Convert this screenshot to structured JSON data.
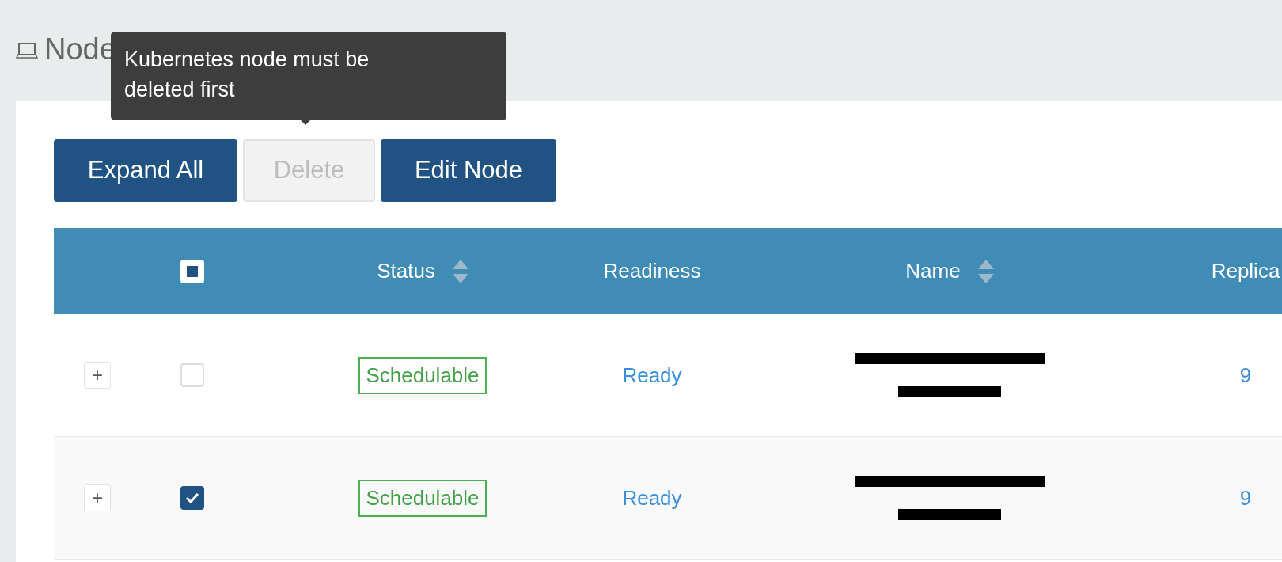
{
  "page": {
    "title": "Node"
  },
  "tooltip": {
    "text": "Kubernetes node must be deleted first"
  },
  "toolbar": {
    "buttons": [
      {
        "label": "Expand All",
        "disabled": false
      },
      {
        "label": "Delete",
        "disabled": true
      },
      {
        "label": "Edit Node",
        "disabled": false
      }
    ]
  },
  "table": {
    "select_all": {
      "indeterminate": true
    },
    "columns": [
      {
        "label": "Status",
        "sortable": true
      },
      {
        "label": "Readiness",
        "sortable": false
      },
      {
        "label": "Name",
        "sortable": true
      },
      {
        "label": "Replica",
        "sortable": false
      }
    ],
    "rows": [
      {
        "expander": "+",
        "checked": false,
        "status": "Schedulable",
        "readiness": "Ready",
        "name": {
          "kind": "redacted"
        },
        "replicas": "9"
      },
      {
        "expander": "+",
        "checked": true,
        "status": "Schedulable",
        "readiness": "Ready",
        "name": {
          "kind": "redacted"
        },
        "replicas": "9"
      }
    ]
  }
}
